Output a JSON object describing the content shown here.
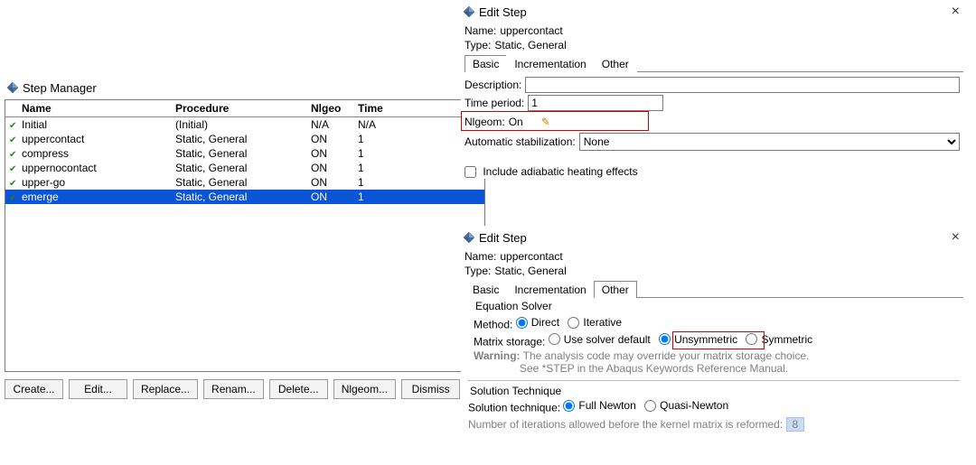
{
  "step_manager": {
    "title": "Step Manager",
    "headers": {
      "name": "Name",
      "procedure": "Procedure",
      "nlgeom": "Nlgeo",
      "time": "Time"
    },
    "rows": [
      {
        "name": "Initial",
        "procedure": "(Initial)",
        "nlgeom": "N/A",
        "time": "N/A",
        "selected": false
      },
      {
        "name": "uppercontact",
        "procedure": "Static, General",
        "nlgeom": "ON",
        "time": "1",
        "selected": false
      },
      {
        "name": "compress",
        "procedure": "Static, General",
        "nlgeom": "ON",
        "time": "1",
        "selected": false
      },
      {
        "name": "uppernocontact",
        "procedure": "Static, General",
        "nlgeom": "ON",
        "time": "1",
        "selected": false
      },
      {
        "name": "upper-go",
        "procedure": "Static, General",
        "nlgeom": "ON",
        "time": "1",
        "selected": false
      },
      {
        "name": "emerge",
        "procedure": "Static, General",
        "nlgeom": "ON",
        "time": "1",
        "selected": true
      }
    ],
    "buttons": {
      "create": "Create...",
      "edit": "Edit...",
      "replace": "Replace...",
      "rename": "Renam...",
      "delete": "Delete...",
      "nlgeom": "Nlgeom...",
      "dismiss": "Dismiss"
    }
  },
  "edit_basic": {
    "title": "Edit Step",
    "name_label": "Name:",
    "name_value": "uppercontact",
    "type_label": "Type:",
    "type_value": "Static, General",
    "tabs": {
      "basic": "Basic",
      "incr": "Incrementation",
      "other": "Other"
    },
    "desc_label": "Description:",
    "desc_value": "",
    "tp_label": "Time period:",
    "tp_value": "1",
    "nlgeom_label": "Nlgeom:",
    "nlgeom_value": "On",
    "stab_label": "Automatic stabilization:",
    "stab_value": "None",
    "adiabatic_label": "Include adiabatic heating effects"
  },
  "edit_other": {
    "title": "Edit Step",
    "name_label": "Name:",
    "name_value": "uppercontact",
    "type_label": "Type:",
    "type_value": "Static, General",
    "tabs": {
      "basic": "Basic",
      "incr": "Incrementation",
      "other": "Other"
    },
    "eq_title": "Equation Solver",
    "method_label": "Method:",
    "method_direct": "Direct",
    "method_iter": "Iterative",
    "matrix_label": "Matrix storage:",
    "matrix_default": "Use solver default",
    "matrix_unsym": "Unsymmetric",
    "matrix_sym": "Symmetric",
    "warn_label": "Warning:",
    "warn_l1": "The analysis code may override your matrix storage choice.",
    "warn_l2": "See *STEP in the Abaqus Keywords Reference Manual.",
    "soltech_title": "Solution Technique",
    "soltech_label": "Solution technique:",
    "soltech_full": "Full Newton",
    "soltech_quasi": "Quasi-Newton",
    "iter_label": "Number of iterations allowed before the kernel matrix is reformed:",
    "iter_value": "8"
  }
}
